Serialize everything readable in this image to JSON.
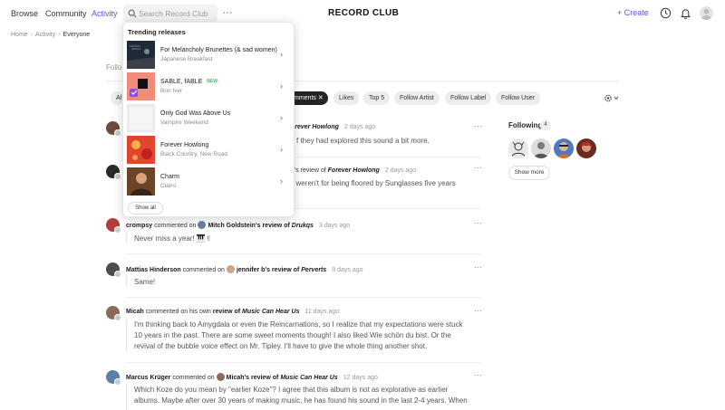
{
  "nav": {
    "browse": "Browse",
    "community": "Community",
    "activity": "Activity",
    "search_placeholder": "Search Record Club",
    "more": "···",
    "logo": "RECORD CLUB",
    "create": "Create",
    "accent": "#6b4de6"
  },
  "breadcrumb": {
    "home": "Home",
    "activity": "Activity",
    "current": "Everyone"
  },
  "page": {
    "follo": "Follo"
  },
  "filters": {
    "a": "Al",
    "comments": "mments",
    "comments_close": "✕",
    "likes": "Likes",
    "top5": "Top 5",
    "follow_artist": "Follow Artist",
    "follow_label": "Follow Label",
    "follow_user": "Follow User"
  },
  "dropdown": {
    "title": "Trending releases",
    "releases": [
      {
        "title": "For Melancholy Brunettes (& sad women)",
        "artist": "Japanese Breakfast"
      },
      {
        "title": "SABLE, fABLE",
        "artist": "Bon Iver",
        "badge": "NEW"
      },
      {
        "title": "Only God Was Above Us",
        "artist": "Vampire Weekend"
      },
      {
        "title": "Forever Howlong",
        "artist": "Black Country, New Road"
      },
      {
        "title": "Charm",
        "artist": "Clairo"
      }
    ],
    "show_all": "Show all"
  },
  "feed": [
    {
      "user": "",
      "action": "",
      "target_user": "",
      "review_of": "orever Howlong",
      "time": "2 days ago",
      "body": [
        "f they had explored this sound a bit more."
      ]
    },
    {
      "user": "",
      "action": "",
      "target_user": "n's review of",
      "review_of": "Forever Howlong",
      "time": "2 days ago",
      "body": [
        "t weren't for being floored by Sunglasses five years"
      ]
    },
    {
      "user": "crompsy",
      "action": "commented on",
      "target_user": "Mitch Goldstein's review of",
      "review_of": "Drukqs",
      "time": "3 days ago",
      "body": [
        "Never miss a year! 🎹✌"
      ]
    },
    {
      "user": "Mattias Hinderson",
      "action": "commented on",
      "target_user": "jennifer b's review of",
      "review_of": "Perverts",
      "time": "9 days ago",
      "body": [
        "Same!"
      ]
    },
    {
      "user": "Micah",
      "action": "commented on his own",
      "target_user": "review of",
      "review_of": "Music Can Hear Us",
      "time": "11 days ago",
      "body": [
        "I'm thinking back to Amygdala or even the Reincarnations, so I realize that my expectations were stuck",
        "10 years in the past. There are some sweet moments though! I also liked Wie schön du bist. Or the",
        "revival of the bubble voice effect on Mr. Tipley. I'll have to give the whole thing another shot."
      ]
    },
    {
      "user": "Marcus Krüger",
      "action": "commented on",
      "target_user": "Micah's review of",
      "review_of": "Music Can Hear Us",
      "time": "12 days ago",
      "body": [
        "Which Koze do you mean by \"earlier Koze\"? I agree that this album is not as explorative as earlier",
        "albums. Maybe after over 30 years of making music, he has found his sound in the last 2-4 years. When"
      ]
    }
  ],
  "following": {
    "title": "Following",
    "count": "4",
    "show_more": "Show more"
  }
}
